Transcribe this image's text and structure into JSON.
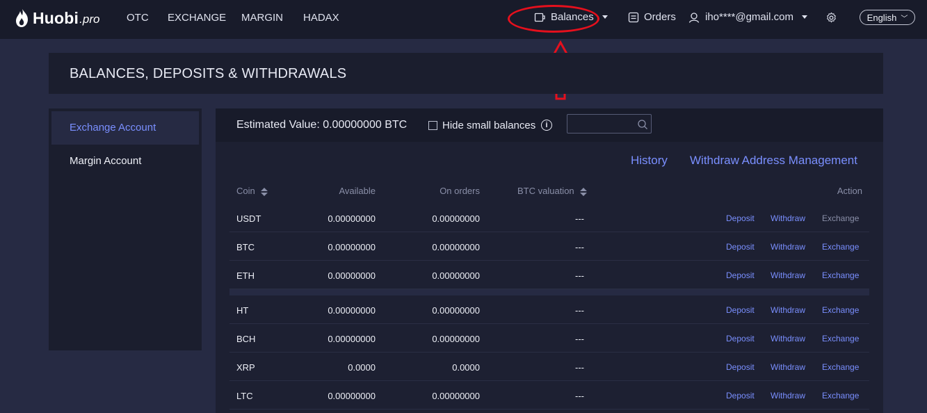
{
  "header": {
    "logo_text": "Huobi",
    "logo_sub": ".pro",
    "nav": [
      "OTC",
      "EXCHANGE",
      "MARGIN",
      "HADAX"
    ],
    "balances_label": "Balances",
    "orders_label": "Orders",
    "user_email": "iho****@gmail.com",
    "language": "English"
  },
  "page_title": "BALANCES, DEPOSITS & WITHDRAWALS",
  "sidebar": {
    "items": [
      {
        "label": "Exchange Account",
        "active": true
      },
      {
        "label": "Margin Account",
        "active": false
      }
    ]
  },
  "main": {
    "estimated_value": "Estimated Value: 0.00000000 BTC",
    "hide_small_label": "Hide small balances",
    "search_placeholder": "",
    "history_link": "History",
    "withdraw_mgmt_link": "Withdraw Address Management",
    "columns": [
      "Coin",
      "Available",
      "On orders",
      "BTC valuation",
      "Action"
    ],
    "actions": {
      "deposit": "Deposit",
      "withdraw": "Withdraw",
      "exchange": "Exchange"
    },
    "rows": [
      {
        "coin": "USDT",
        "available": "0.00000000",
        "on_orders": "0.00000000",
        "btc": "---",
        "exchange_disabled": true
      },
      {
        "coin": "BTC",
        "available": "0.00000000",
        "on_orders": "0.00000000",
        "btc": "---",
        "exchange_disabled": false
      },
      {
        "coin": "ETH",
        "available": "0.00000000",
        "on_orders": "0.00000000",
        "btc": "---",
        "exchange_disabled": false
      },
      {
        "coin": "HT",
        "available": "0.00000000",
        "on_orders": "0.00000000",
        "btc": "---",
        "exchange_disabled": false
      },
      {
        "coin": "BCH",
        "available": "0.00000000",
        "on_orders": "0.00000000",
        "btc": "---",
        "exchange_disabled": false
      },
      {
        "coin": "XRP",
        "available": "0.0000",
        "on_orders": "0.0000",
        "btc": "---",
        "exchange_disabled": false
      },
      {
        "coin": "LTC",
        "available": "0.00000000",
        "on_orders": "0.00000000",
        "btc": "---",
        "exchange_disabled": false
      }
    ]
  },
  "colors": {
    "accent": "#7a8fff",
    "annotation": "#e5101d",
    "page_bg": "#262a43",
    "panel_bg": "#1b1e2e"
  }
}
